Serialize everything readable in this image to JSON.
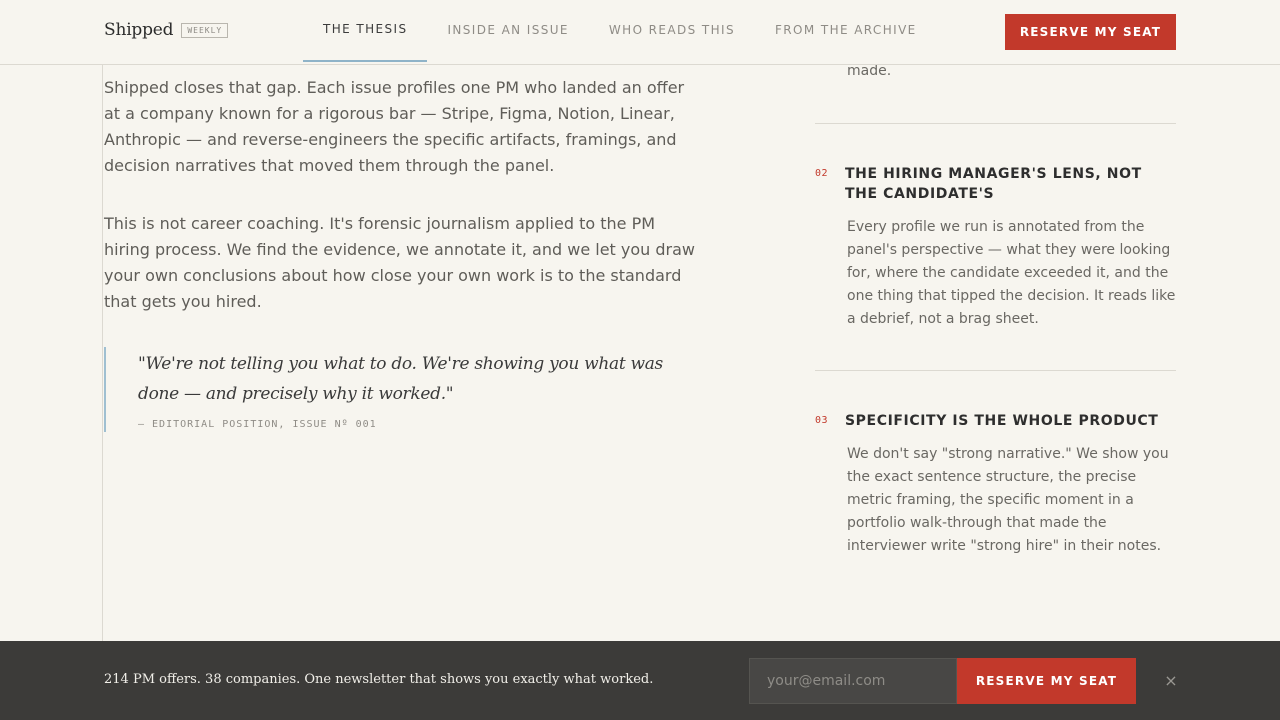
{
  "header": {
    "brand": "Shipped",
    "badge": "WEEKLY",
    "nav": [
      {
        "label": "The Thesis",
        "active": true
      },
      {
        "label": "Inside an Issue",
        "active": false
      },
      {
        "label": "Who Reads This",
        "active": false
      },
      {
        "label": "From the Archive",
        "active": false
      }
    ],
    "cta": "RESERVE MY SEAT"
  },
  "main": {
    "paragraphs": [
      "Shipped closes that gap. Each issue profiles one PM who landed an offer at a company known for a rigorous bar — Stripe, Figma, Notion, Linear, Anthropic — and reverse-engineers the specific artifacts, framings, and decision narratives that moved them through the panel.",
      "This is not career coaching. It's forensic journalism applied to the PM hiring process. We find the evidence, we annotate it, and we let you draw your own conclusions about how close your own work is to the standard that gets you hired."
    ],
    "quote": {
      "text": "\"We're not telling you what to do. We're showing you what was done — and precisely why it worked.\"",
      "attribution": "— EDITORIAL POSITION, ISSUE Nº 001"
    }
  },
  "aside": {
    "fragment": "made.",
    "points": [
      {
        "num": "02",
        "title": "The hiring manager's lens, not the candidate's",
        "body": "Every profile we run is annotated from the panel's perspective — what they were looking for, where the candidate exceeded it, and the one thing that tipped the decision. It reads like a debrief, not a brag sheet."
      },
      {
        "num": "03",
        "title": "Specificity is the whole product",
        "body": "We don't say \"strong narrative.\" We show you the exact sentence structure, the precise metric framing, the specific moment in a portfolio walk-through that made the interviewer write \"strong hire\" in their notes."
      }
    ]
  },
  "bottom_bar": {
    "text": "214 PM offers. 38 companies. One newsletter that shows you exactly what worked.",
    "email_placeholder": "your@email.com",
    "cta": "RESERVE MY SEAT",
    "close": "×"
  },
  "colors": {
    "background": "#f7f5ef",
    "accent": "#c2392b",
    "quote_rule": "#9fbfd1",
    "bottom_bar": "#3c3b39"
  }
}
